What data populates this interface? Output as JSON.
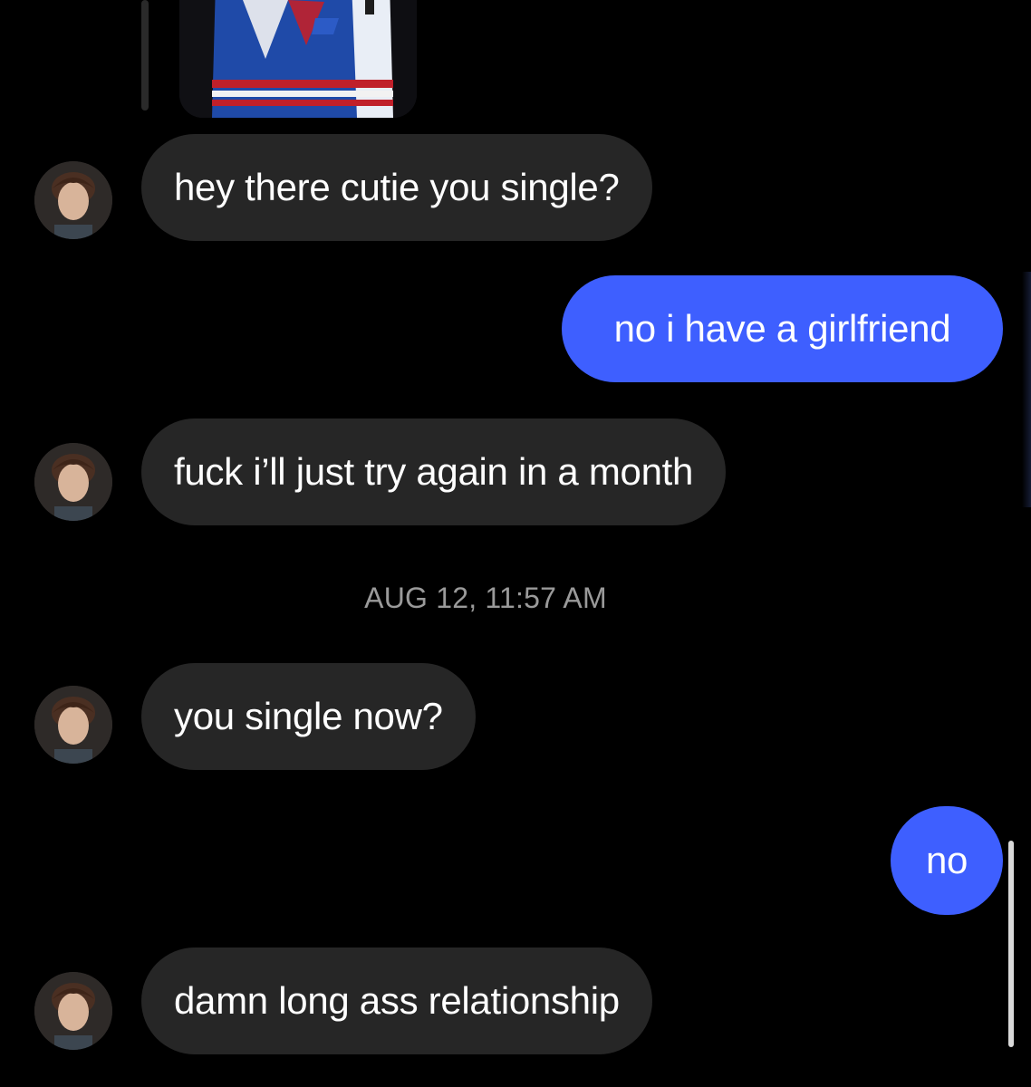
{
  "thread": {
    "messages": [
      {
        "id": "m1",
        "sender": "them",
        "text": "hey there cutie you single?"
      },
      {
        "id": "m2",
        "sender": "me",
        "text": "no i have a girlfriend"
      },
      {
        "id": "m3",
        "sender": "them",
        "text": "fuck i’ll just try again in a month"
      },
      {
        "id": "m4",
        "sender": "them",
        "text": "you single now?"
      },
      {
        "id": "m5",
        "sender": "me",
        "text": "no"
      },
      {
        "id": "m6",
        "sender": "them",
        "text": "damn long ass relationship"
      }
    ],
    "timestamp": "AUG 12, 11:57 AM"
  },
  "colors": {
    "background": "#000000",
    "incoming_bubble": "#262626",
    "outgoing_bubble": "#3e5fff",
    "timestamp_text": "#9a9a9a"
  },
  "icons": {
    "avatar": "profile-photo",
    "shared_image": "hockey-jersey-photo"
  }
}
